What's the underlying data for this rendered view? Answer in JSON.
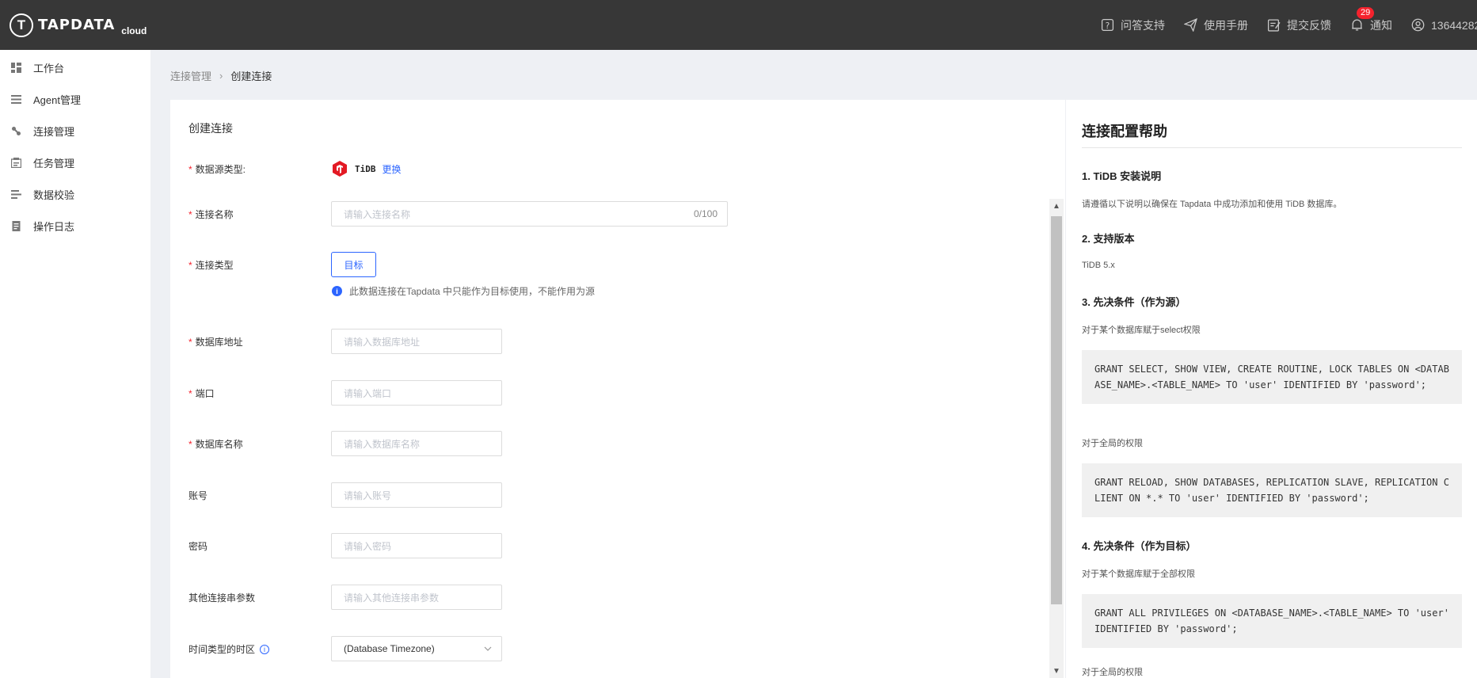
{
  "app": {
    "logo_text": "TAPDATA",
    "logo_suffix": "cloud"
  },
  "topbar": {
    "actions": [
      {
        "label": "问答支持",
        "icon": "question-icon"
      },
      {
        "label": "使用手册",
        "icon": "paper-plane-icon"
      },
      {
        "label": "提交反馈",
        "icon": "feedback-icon"
      },
      {
        "label": "通知",
        "icon": "bell-icon",
        "badge": "29"
      },
      {
        "label": "13644282",
        "icon": "user-icon"
      }
    ]
  },
  "sidebar": {
    "items": [
      {
        "label": "工作台"
      },
      {
        "label": "Agent管理"
      },
      {
        "label": "连接管理"
      },
      {
        "label": "任务管理"
      },
      {
        "label": "数据校验"
      },
      {
        "label": "操作日志"
      }
    ]
  },
  "breadcrumb": {
    "parent": "连接管理",
    "current": "创建连接"
  },
  "form": {
    "title": "创建连接",
    "datasource_label": "数据源类型:",
    "datasource_name": "TiDB",
    "datasource_change": "更换",
    "name_label": "连接名称",
    "name_placeholder": "请输入连接名称",
    "name_counter": "0/100",
    "type_label": "连接类型",
    "type_value": "目标",
    "type_hint": "此数据连接在Tapdata 中只能作为目标使用，不能作用为源",
    "host_label": "数据库地址",
    "host_placeholder": "请输入数据库地址",
    "port_label": "端口",
    "port_placeholder": "请输入端口",
    "db_label": "数据库名称",
    "db_placeholder": "请输入数据库名称",
    "user_label": "账号",
    "user_placeholder": "请输入账号",
    "password_label": "密码",
    "password_placeholder": "请输入密码",
    "extra_label": "其他连接串参数",
    "extra_placeholder": "请输入其他连接串参数",
    "timezone_label": "时间类型的时区",
    "timezone_value": "(Database Timezone)"
  },
  "help": {
    "title": "连接配置帮助",
    "s1_title": "1. TiDB 安装说明",
    "s1_text": "请遵循以下说明以确保在 Tapdata 中成功添加和使用 TiDB 数据库。",
    "s2_title": "2. 支持版本",
    "s2_text": "TiDB 5.x",
    "s3_title": "3. 先决条件（作为源）",
    "s3_text1": "对于某个数据库赋于select权限",
    "s3_code1": "GRANT SELECT, SHOW VIEW, CREATE ROUTINE, LOCK TABLES ON <DATABASE_NAME>.<TABLE_NAME> TO 'user' IDENTIFIED BY 'password';",
    "s3_text2": "对于全局的权限",
    "s3_code2": "GRANT RELOAD, SHOW DATABASES, REPLICATION SLAVE, REPLICATION CLIENT ON *.* TO 'user' IDENTIFIED BY 'password';",
    "s4_title": "4. 先决条件（作为目标）",
    "s4_text1": "对于某个数据库赋于全部权限",
    "s4_code1": "GRANT ALL PRIVILEGES ON <DATABASE_NAME>.<TABLE_NAME> TO 'user' IDENTIFIED BY 'password';",
    "s4_text2": "对于全局的权限"
  },
  "colors": {
    "accent": "#2c65ff",
    "topbar": "#373737",
    "required": "#f5222d"
  }
}
